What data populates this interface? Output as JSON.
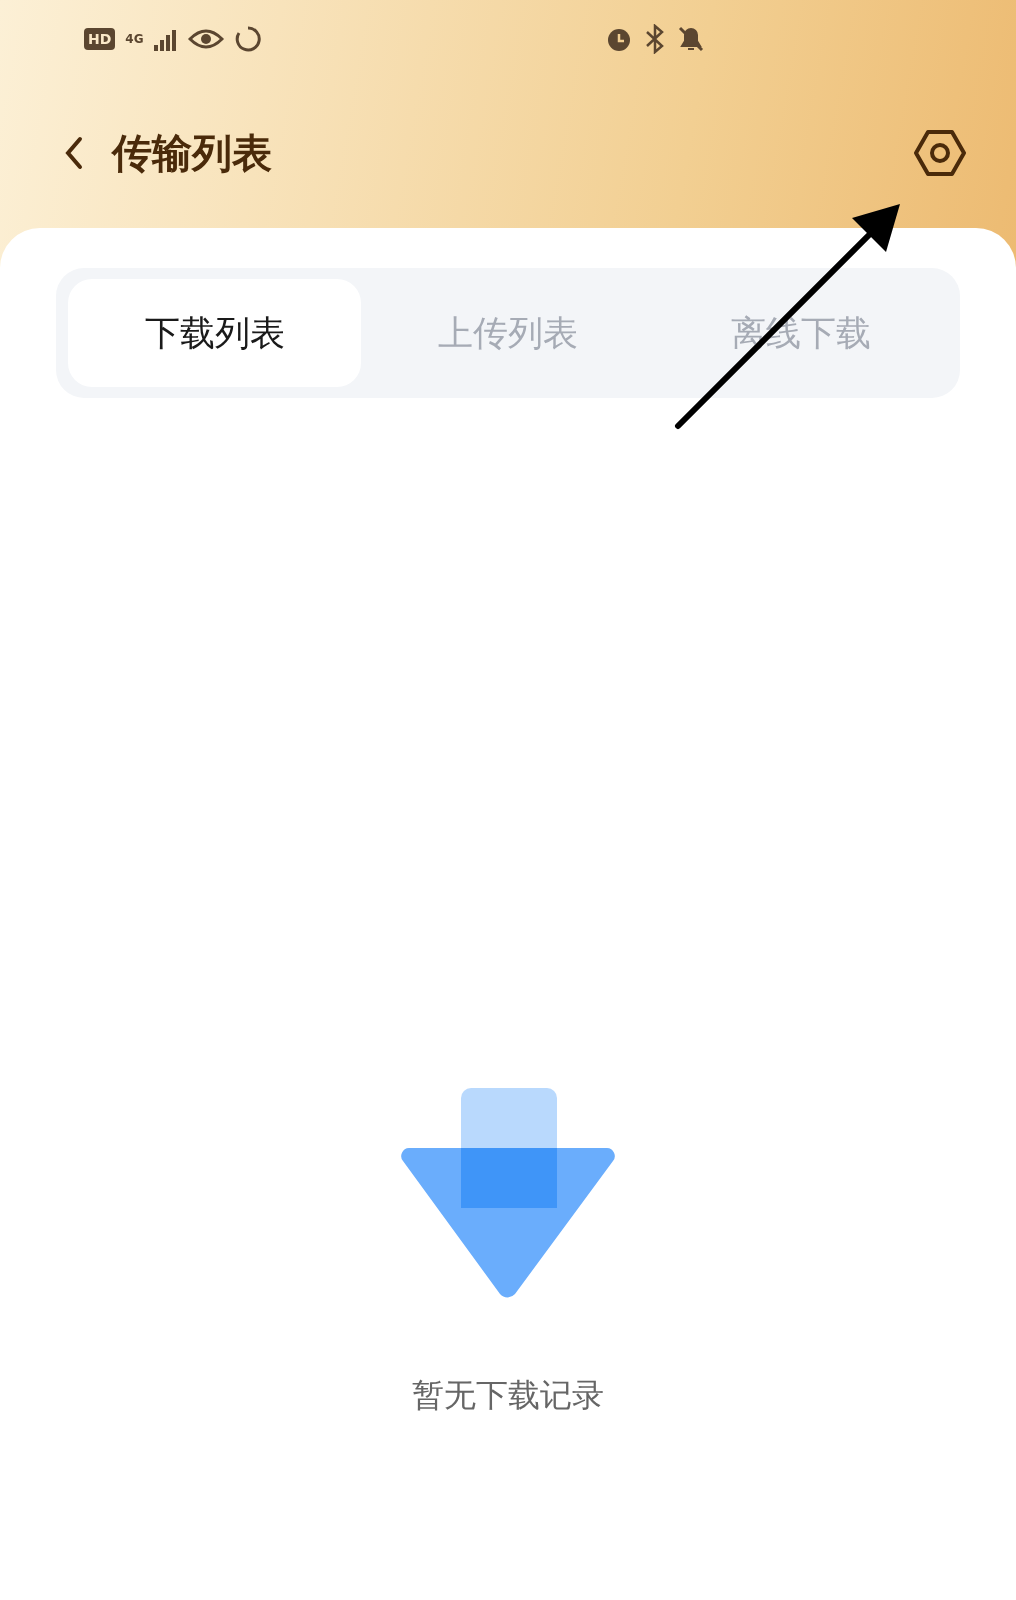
{
  "status_bar": {
    "badges": [
      "HD",
      "4G"
    ]
  },
  "header": {
    "title": "传输列表"
  },
  "tabs": [
    {
      "label": "下载列表",
      "selected": true
    },
    {
      "label": "上传列表",
      "selected": false
    },
    {
      "label": "离线下载",
      "selected": false
    }
  ],
  "empty_state": {
    "message": "暂无下载记录"
  }
}
